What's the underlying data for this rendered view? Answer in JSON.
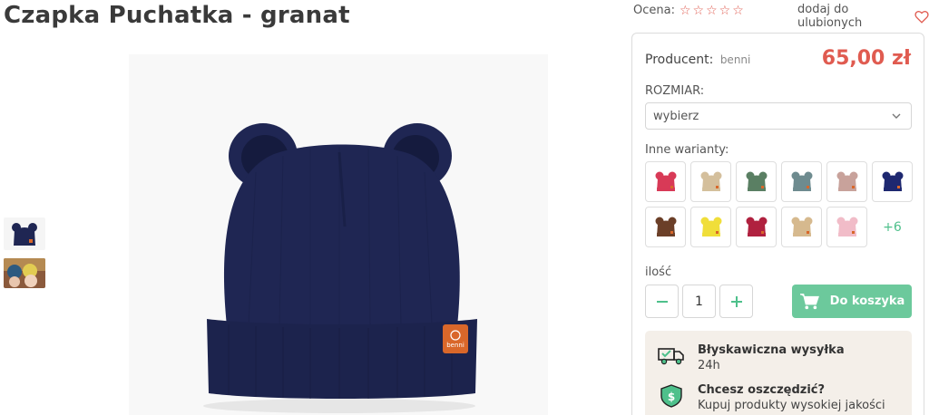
{
  "product": {
    "title": "Czapka Puchatka - granat",
    "rating_label": "Ocena:",
    "favorite_label": "dodaj do ulubionych",
    "producer_label": "Producent:",
    "producer_name": "benni",
    "price": "65,00 zł",
    "size_label": "ROZMIAR:",
    "size_selected": "wybierz",
    "variants_label": "Inne warianty:",
    "variants": [
      {
        "name": "raspberry",
        "color": "#d83a57"
      },
      {
        "name": "beige",
        "color": "#d4bf9c"
      },
      {
        "name": "green",
        "color": "#5a7f63"
      },
      {
        "name": "teal-grey",
        "color": "#6e8b8f"
      },
      {
        "name": "dusty-pink",
        "color": "#c8a29b"
      },
      {
        "name": "navy",
        "color": "#1e2870"
      },
      {
        "name": "brown",
        "color": "#6b3f28"
      },
      {
        "name": "yellow",
        "color": "#f0de3a"
      },
      {
        "name": "burgundy",
        "color": "#b0213f"
      },
      {
        "name": "sand",
        "color": "#d6b98e"
      },
      {
        "name": "light-pink",
        "color": "#f1bcc8"
      }
    ],
    "more_variants": "+6",
    "quantity_label": "ilość",
    "quantity_value": "1",
    "add_to_cart": "Do koszyka",
    "info": [
      {
        "title": "Błyskawiczna wysyłka",
        "sub": "24h",
        "icon": "truck-icon"
      },
      {
        "title": "Chcesz oszczędzić?",
        "sub": "Kupuj produkty wysokiej jakości",
        "icon": "money-shield-icon"
      }
    ],
    "main_hat_color": "#1f2653",
    "label_tag": "benni",
    "accent_red": "#e05b50",
    "accent_green": "#6cc99c"
  }
}
